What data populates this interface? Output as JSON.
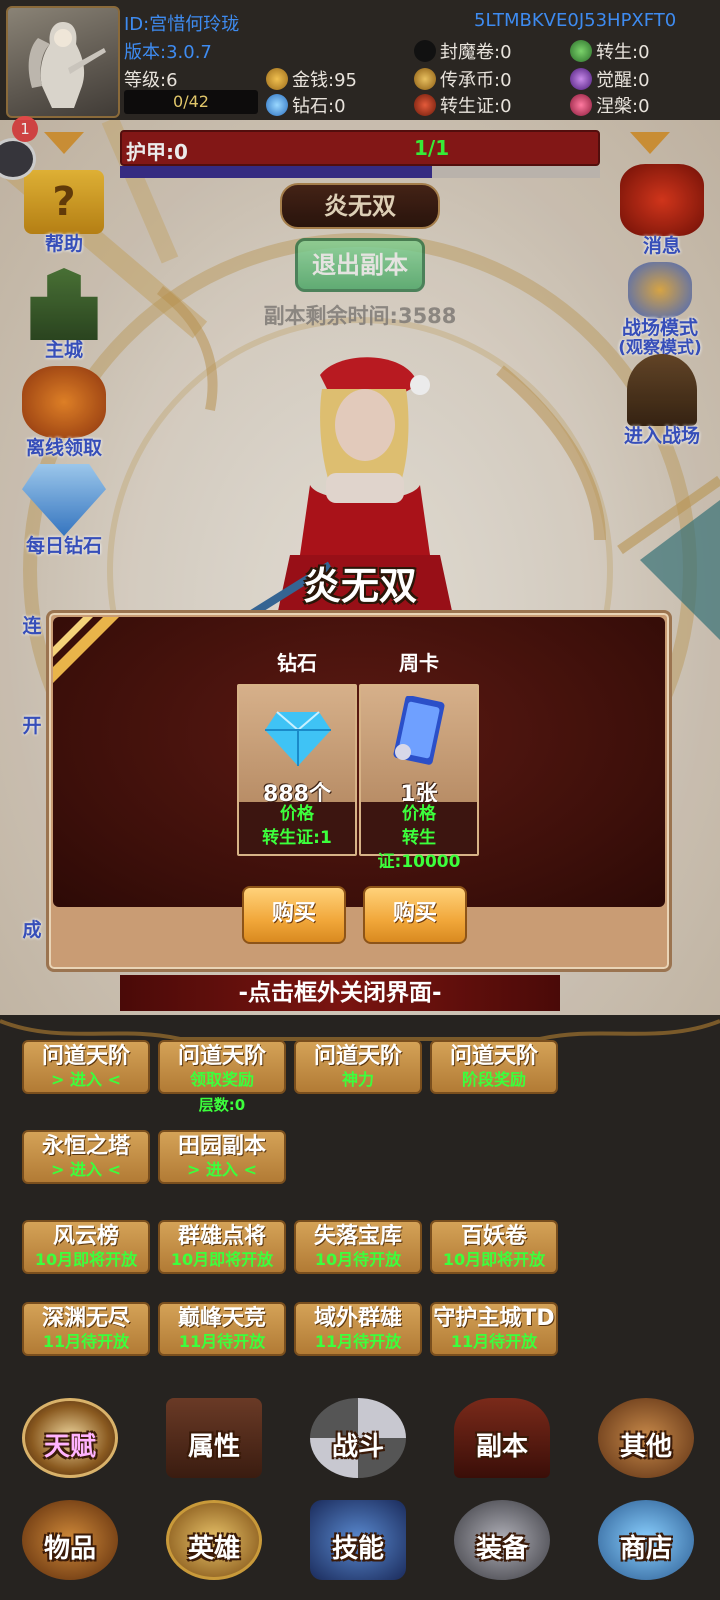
{
  "player": {
    "id": "ID:宫惜何玲珑",
    "code": "5LTMBKVE0J53HPXFT0",
    "version": "版本:3.0.7",
    "level": "等级:6",
    "xp": "0/42",
    "gold": "金钱:95",
    "diamond": "钻石:0",
    "seal_scroll": "封魔卷:0",
    "legacy_coin": "传承币:0",
    "rebirth_cert": "转生证:0",
    "rebirth": "转生:0",
    "awaken": "觉醒:0",
    "nirvana": "涅槃:0",
    "notification_count": "1"
  },
  "armor": {
    "label": "护甲:0",
    "value": "1/1",
    "fill_fraction": 0.65
  },
  "left_menu": [
    {
      "label": "帮助"
    },
    {
      "label": "主城"
    },
    {
      "label": "离线领取"
    },
    {
      "label": "每日钻石"
    },
    {
      "label": "连"
    },
    {
      "label": "开"
    },
    {
      "label": "成"
    }
  ],
  "right_menu": [
    {
      "label": "消息"
    },
    {
      "label": "战场模式",
      "sub": "(观察模式)"
    },
    {
      "label": "进入战场"
    }
  ],
  "dungeon": {
    "title": "炎无双",
    "exit_label": "退出副本",
    "remaining": "副本剩余时间:3588"
  },
  "modal": {
    "title": "炎无双",
    "items": [
      {
        "category": "钻石",
        "amount": "888个",
        "price_label": "价格",
        "price": "转生证:1",
        "buy": "购买",
        "icon": "diamond-icon"
      },
      {
        "category": "周卡",
        "amount": "1张",
        "price_label": "价格",
        "price": "转生证:10000",
        "buy": "购买",
        "icon": "weekly-card-icon"
      }
    ],
    "close_hint": "-点击框外关闭界面-"
  },
  "features": [
    {
      "name": "问道天阶",
      "sub": "> 进入 <"
    },
    {
      "name": "问道天阶",
      "sub": "领取奖励"
    },
    {
      "name": "问道天阶",
      "sub": "神力"
    },
    {
      "name": "问道天阶",
      "sub": "阶段奖励"
    },
    {
      "name": "永恒之塔",
      "sub": "> 进入 <"
    },
    {
      "name": "田园副本",
      "sub": "> 进入 <"
    },
    {
      "name": "风云榜",
      "sub": "10月即将开放"
    },
    {
      "name": "群雄点将",
      "sub": "10月即将开放"
    },
    {
      "name": "失落宝库",
      "sub": "10月待开放"
    },
    {
      "name": "百妖卷",
      "sub": "10月即将开放"
    },
    {
      "name": "深渊无尽",
      "sub": "11月待开放"
    },
    {
      "name": "巅峰天竞",
      "sub": "11月待开放"
    },
    {
      "name": "域外群雄",
      "sub": "11月待开放"
    },
    {
      "name": "守护主城TD",
      "sub": "11月待开放"
    }
  ],
  "floor": "层数:0",
  "bottom_nav": [
    {
      "label": "天赋"
    },
    {
      "label": "属性"
    },
    {
      "label": "战斗"
    },
    {
      "label": "副本"
    },
    {
      "label": "其他"
    },
    {
      "label": "物品"
    },
    {
      "label": "英雄"
    },
    {
      "label": "技能"
    },
    {
      "label": "装备"
    },
    {
      "label": "商店"
    }
  ],
  "colors": {
    "id_text": "#3e8bf0",
    "price_text": "#3cff3c",
    "armor_bar": "#8e1a18",
    "button_gold": "#f1a73a"
  }
}
